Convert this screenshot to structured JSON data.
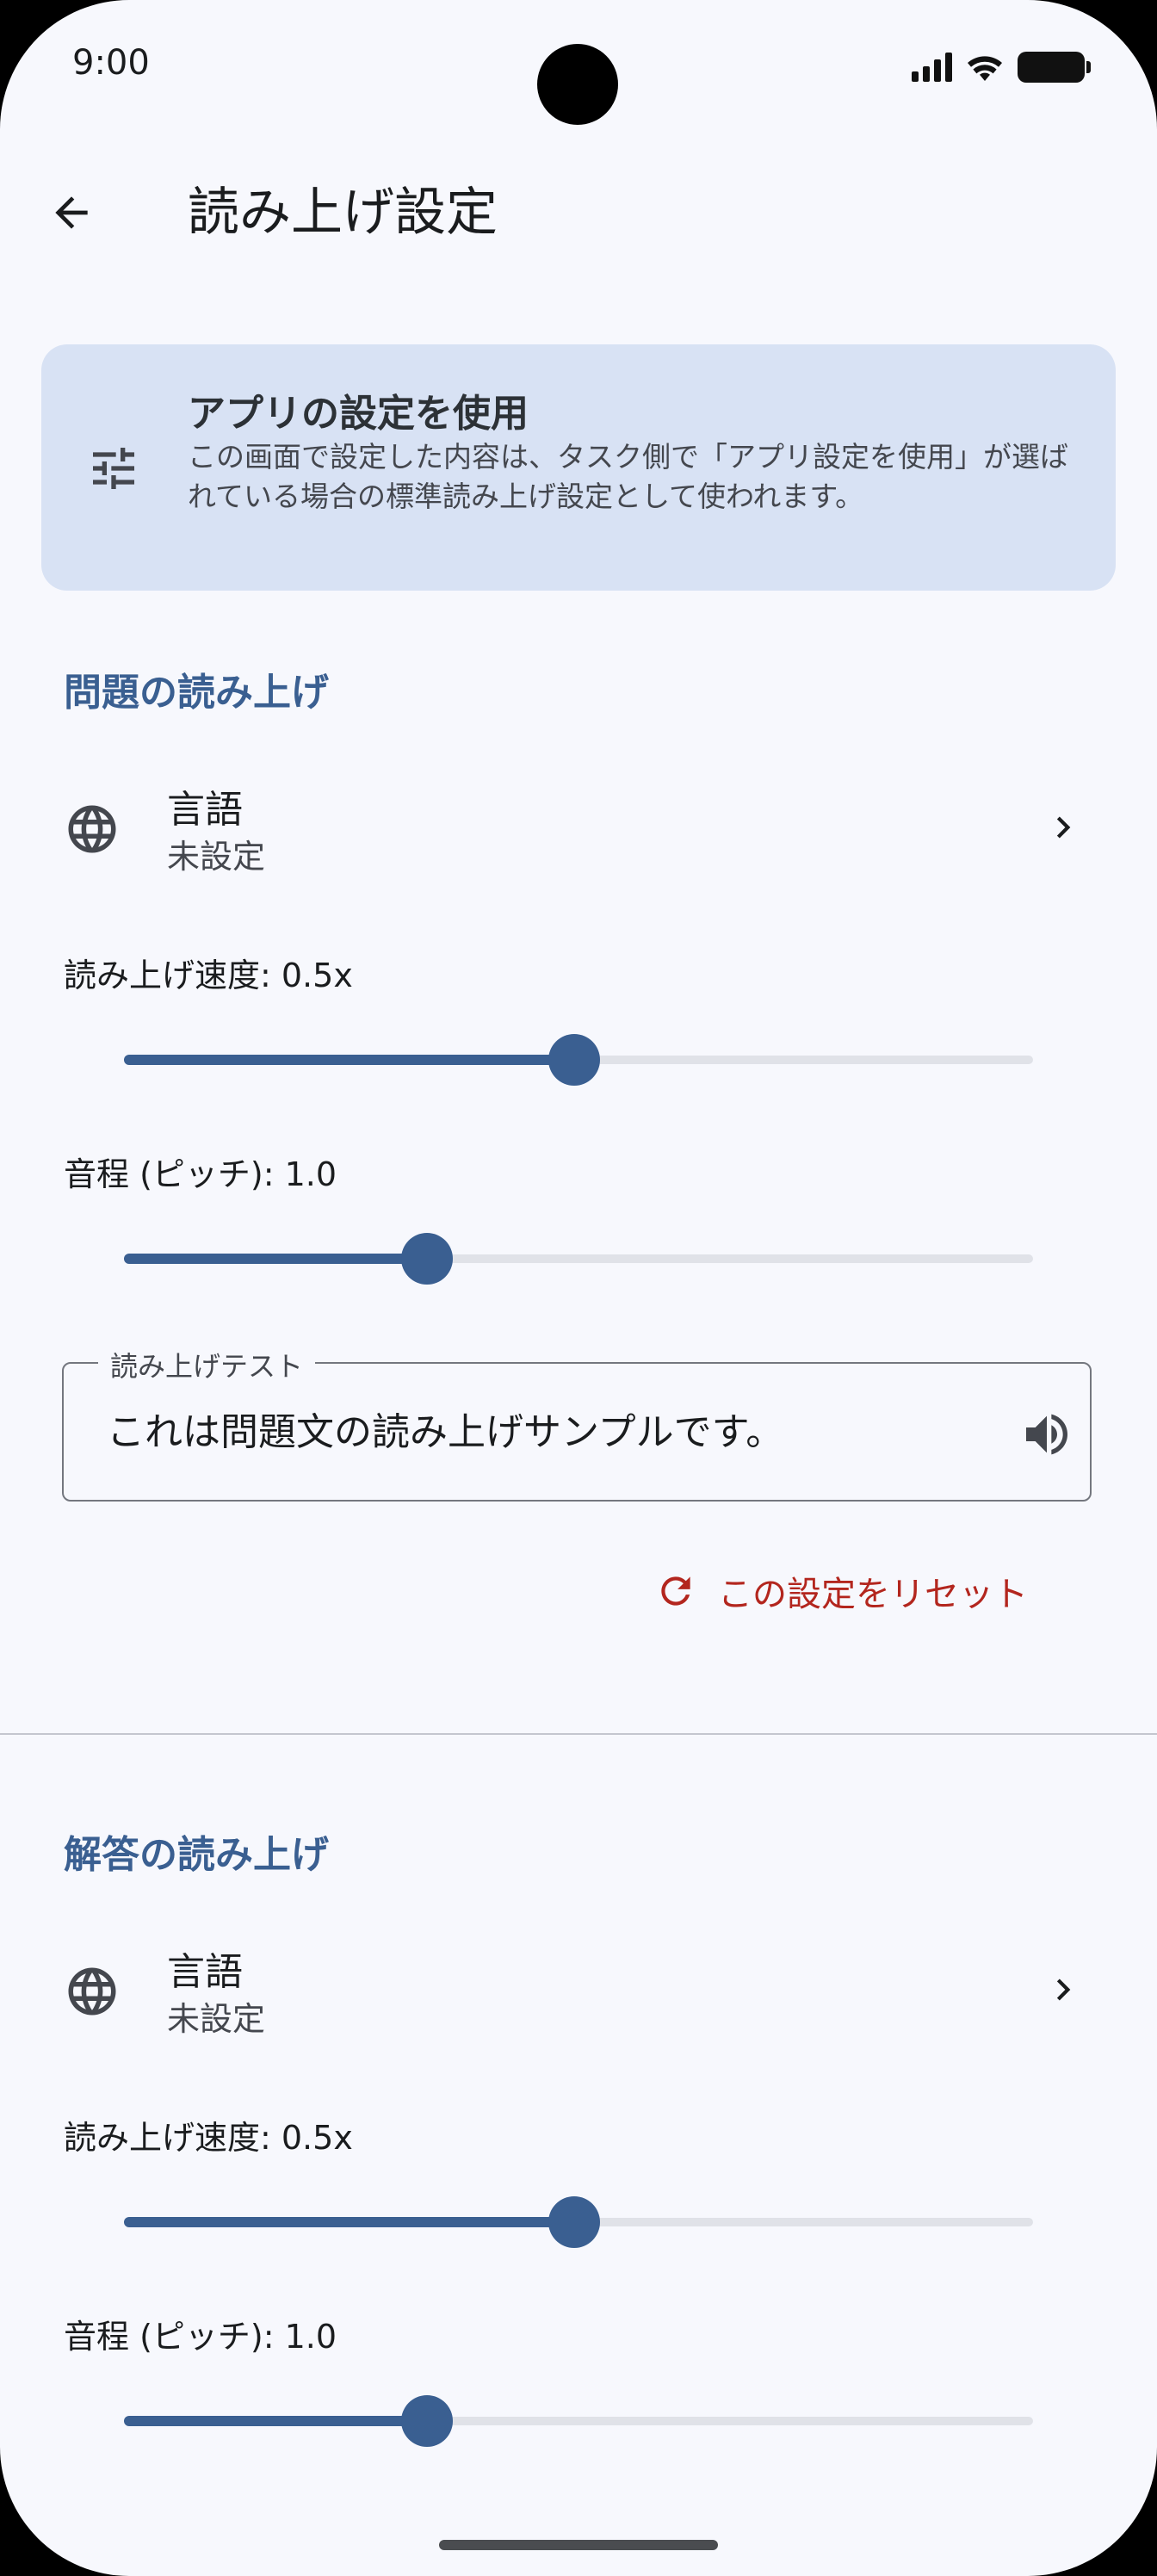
{
  "status_bar": {
    "time": "9:00"
  },
  "app_bar": {
    "title": "読み上げ設定"
  },
  "info_card": {
    "icon": "tune-icon",
    "title": "アプリの設定を使用",
    "description": "この画面で設定した内容は、タスク側で「アプリ設定を使用」が選ばれている場合の標準読み上げ設定として使われます。"
  },
  "question_section": {
    "header": "問題の読み上げ",
    "language": {
      "title": "言語",
      "value": "未設定"
    },
    "speed": {
      "label": "読み上げ速度: 0.5x",
      "fraction": 0.495
    },
    "pitch": {
      "label": "音程 (ピッチ): 1.0",
      "fraction": 0.333
    },
    "test": {
      "legend": "読み上げテスト",
      "value": "これは問題文の読み上げサンプルです。"
    },
    "reset_label": "この設定をリセット"
  },
  "answer_section": {
    "header": "解答の読み上げ",
    "language": {
      "title": "言語",
      "value": "未設定"
    },
    "speed": {
      "label": "読み上げ速度: 0.5x",
      "fraction": 0.495
    },
    "pitch": {
      "label": "音程 (ピッチ): 1.0",
      "fraction": 0.333
    }
  },
  "colors": {
    "accent": "#3a5f91",
    "card_bg": "#d8e2f4",
    "reset": "#b3261e",
    "background": "#f7f8fd"
  }
}
